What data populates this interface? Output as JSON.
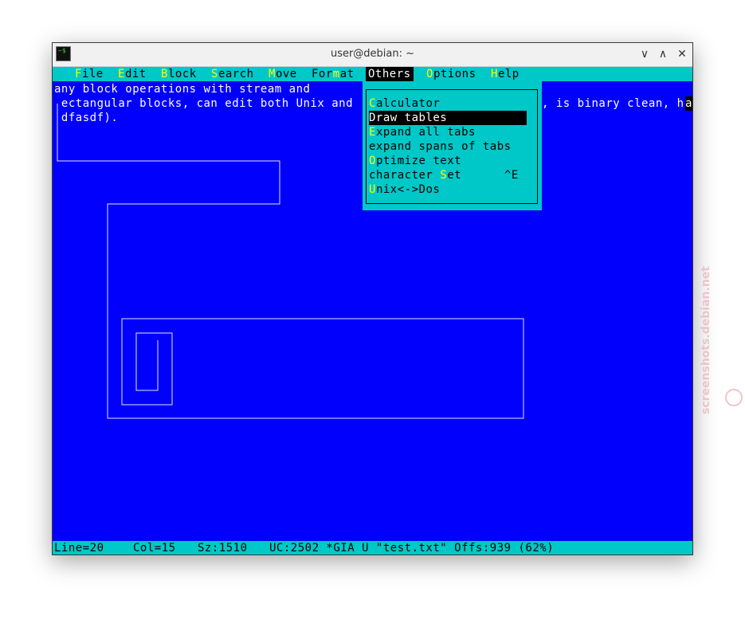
{
  "window": {
    "title": "user@debian: ~",
    "icon_text": "~$",
    "buttons": {
      "minimize": "∨",
      "maximize": "∧",
      "close": "✕"
    }
  },
  "menubar": {
    "items": [
      {
        "hot": "F",
        "rest": "ile"
      },
      {
        "hot": "E",
        "rest": "dit"
      },
      {
        "hot": "B",
        "rest": "lock"
      },
      {
        "hot": "S",
        "rest": "earch"
      },
      {
        "hot": "M",
        "rest": "ove"
      },
      {
        "pre": "For",
        "hot": "m",
        "rest": "at"
      },
      {
        "label": "Others"
      },
      {
        "hot": "O",
        "rest": "ptions"
      },
      {
        "hot": "H",
        "rest": "elp"
      }
    ]
  },
  "editor": {
    "lines": [
      "any block operations with stream and",
      " ectangular blocks, can edit both Unix and",
      " dfasdf)."
    ],
    "right_text": ", is binary clean, h",
    "cursor_char": "a"
  },
  "others_menu": {
    "items": [
      {
        "hot": "C",
        "rest": "alculator"
      },
      {
        "label": "Draw tables",
        "selected": true
      },
      {
        "hot": "E",
        "rest": "xpand all tabs"
      },
      {
        "label": "expand spans of tabs"
      },
      {
        "hot": "O",
        "rest": "ptimize text"
      },
      {
        "pre": "character ",
        "hot": "S",
        "rest": "et",
        "shortcut": "^E"
      },
      {
        "hot": "U",
        "rest": "nix<->Dos"
      }
    ]
  },
  "statusbar": {
    "line": "Line=20",
    "col": "Col=15",
    "size": "Sz:1510",
    "info": "UC:2502 *GIA U \"test.txt\" Offs:939 (62%)"
  },
  "watermark": "screenshots.debian.net"
}
